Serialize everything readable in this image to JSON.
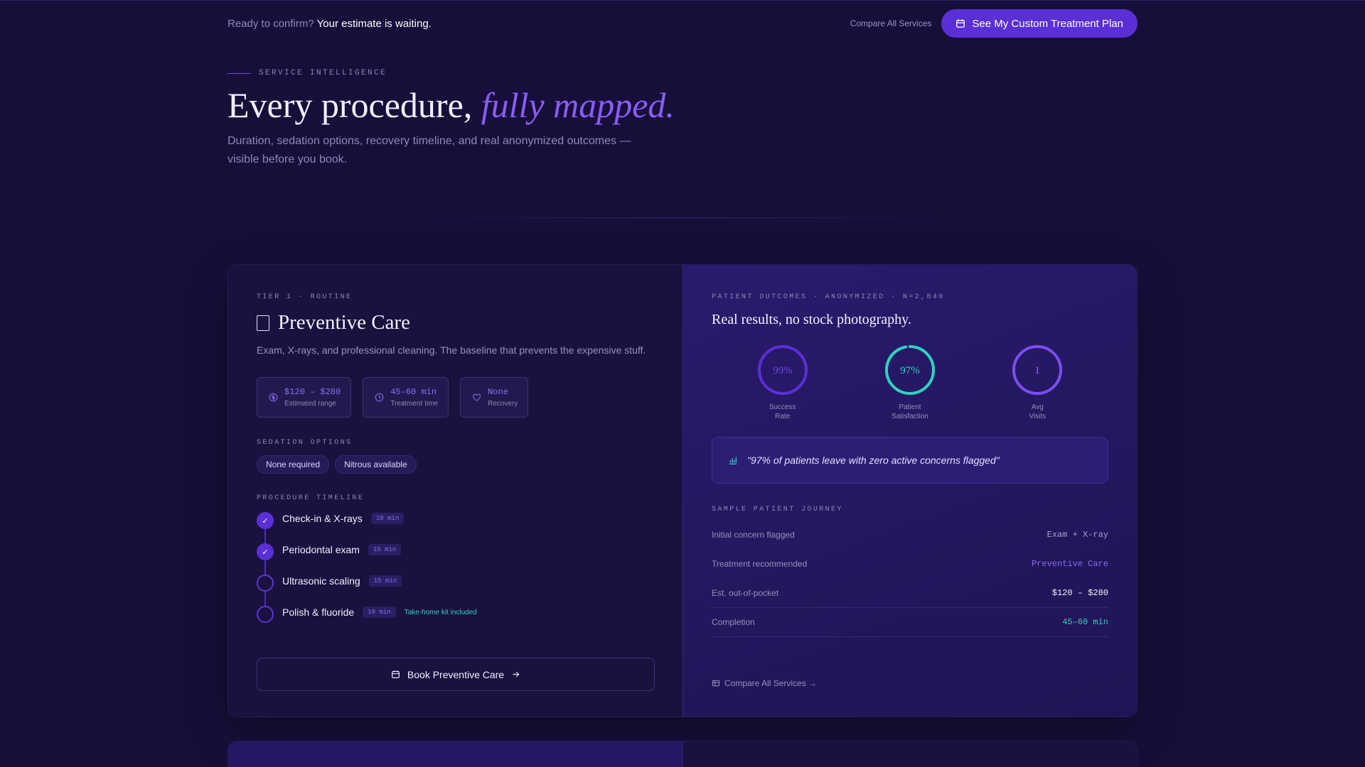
{
  "topbar": {
    "ready_prefix": "Ready to confirm?",
    "ready_emphasis": "Your estimate is waiting.",
    "compare_link": "Compare All Services",
    "cta_label": "See My Custom Treatment Plan"
  },
  "hero": {
    "eyebrow": "SERVICE INTELLIGENCE",
    "title_plain": "Every procedure,",
    "title_accent": "fully mapped.",
    "lede": "Duration, sedation options, recovery timeline, and real anonymized outcomes — visible before you book."
  },
  "service": {
    "tier": "TIER 1 · ROUTINE",
    "icon": "tooth-icon",
    "name": "Preventive Care",
    "description": "Exam, X-rays, and professional cleaning. The baseline that prevents the expensive stuff.",
    "stats": [
      {
        "icon": "dollar-icon",
        "value": "$120 – $280",
        "label": "Estimated range"
      },
      {
        "icon": "clock-icon",
        "value": "45–60 min",
        "label": "Treatment time"
      },
      {
        "icon": "heart-icon",
        "value": "None",
        "label": "Recovery"
      }
    ],
    "sedation_label": "SEDATION OPTIONS",
    "sedation_options": [
      "None required",
      "Nitrous available"
    ],
    "timeline_label": "PROCEDURE TIMELINE",
    "timeline": [
      {
        "name": "Check-in & X-rays",
        "duration": "10 min",
        "done": true,
        "note": ""
      },
      {
        "name": "Periodontal exam",
        "duration": "15 min",
        "done": true,
        "note": ""
      },
      {
        "name": "Ultrasonic scaling",
        "duration": "15 min",
        "done": false,
        "note": ""
      },
      {
        "name": "Polish & fluoride",
        "duration": "10 min",
        "done": false,
        "note": "Take-home kit included"
      }
    ],
    "book_label": "Book Preventive Care"
  },
  "outcomes": {
    "label": "PATIENT OUTCOMES · ANONYMIZED · N=2,840",
    "headline": "Real results, no stock photography.",
    "rings": [
      {
        "value": "99%",
        "label_line1": "Success",
        "label_line2": "Rate",
        "fraction": 0.99,
        "color": "#5b2fd6"
      },
      {
        "value": "97%",
        "label_line1": "Patient",
        "label_line2": "Satisfaction",
        "fraction": 0.97,
        "color": "#2dd4bf"
      },
      {
        "value": "1",
        "label_line1": "Avg",
        "label_line2": "Visits",
        "fraction": 1.0,
        "color": "#7c4df0"
      }
    ],
    "quote": "\"97% of patients leave with zero active concerns flagged\"",
    "journey_label": "SAMPLE PATIENT JOURNEY",
    "journey": [
      {
        "key": "Initial concern flagged",
        "value": "Exam + X-ray",
        "tone": "muted"
      },
      {
        "key": "Treatment recommended",
        "value": "Preventive Care",
        "tone": "purple"
      },
      {
        "key": "Est. out-of-pocket",
        "value": "$120 – $280",
        "tone": "white"
      },
      {
        "key": "Completion",
        "value": "45–60 min",
        "tone": "teal"
      }
    ],
    "compare_link": "Compare All Services →"
  }
}
